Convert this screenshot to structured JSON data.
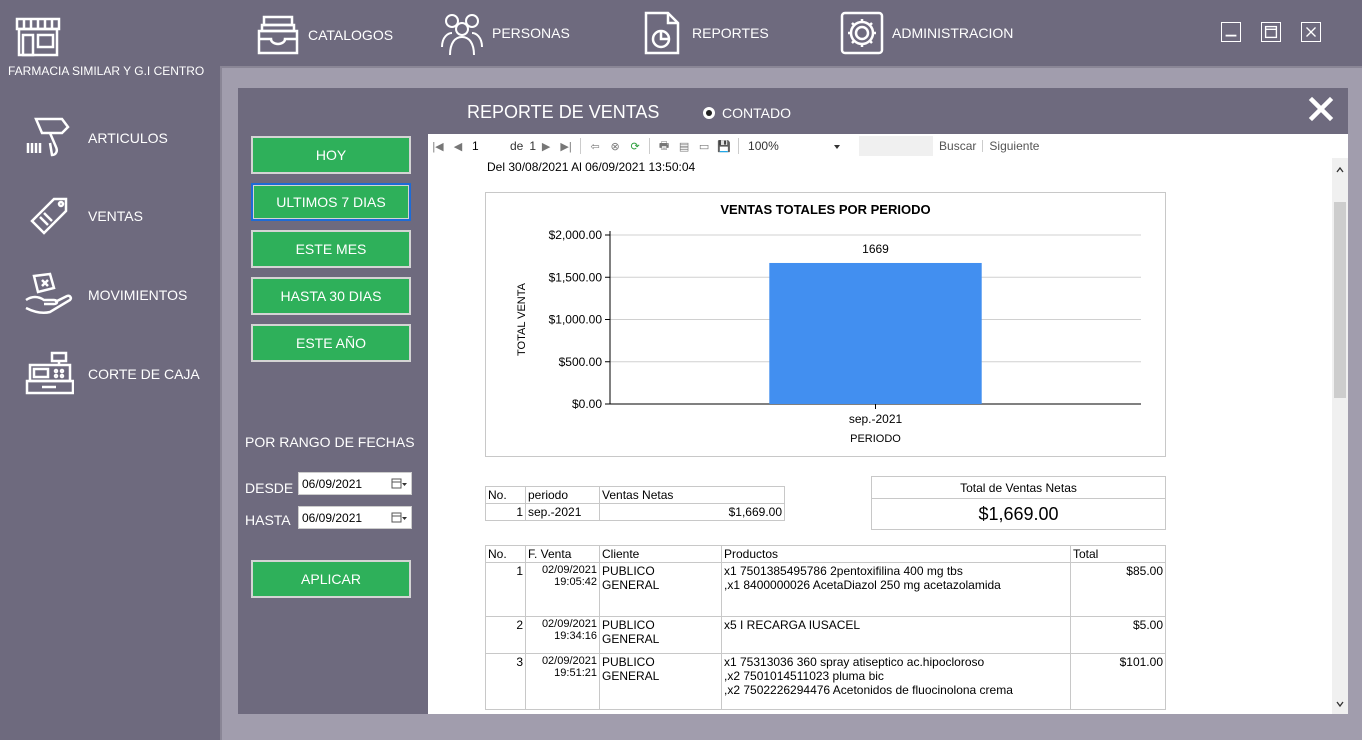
{
  "brand": {
    "name": "FARMACIA SIMILAR Y G.I CENTRO"
  },
  "topnav": {
    "catalogos": "CATALOGOS",
    "personas": "PERSONAS",
    "reportes": "REPORTES",
    "administracion": "ADMINISTRACION"
  },
  "sidebar": {
    "items": [
      {
        "label": "ARTICULOS"
      },
      {
        "label": "VENTAS"
      },
      {
        "label": "MOVIMIENTOS"
      },
      {
        "label": "CORTE DE CAJA"
      }
    ]
  },
  "report": {
    "title": "REPORTE DE VENTAS",
    "radio_label": "CONTADO",
    "buttons": {
      "hoy": "HOY",
      "ultimos7": "ULTIMOS 7 DIAS",
      "este_mes": "ESTE MES",
      "hasta30": "HASTA 30 DIAS",
      "este_anio": "ESTE AÑO",
      "aplicar": "APLICAR"
    },
    "range_label": "POR RANGO DE FECHAS",
    "desde_label": "DESDE",
    "desde_value": "06/09/2021",
    "hasta_label": "HASTA",
    "hasta_value": "06/09/2021"
  },
  "viewer": {
    "page_current": "1",
    "page_of": "de",
    "page_total": "1",
    "zoom": "100%",
    "buscar": "Buscar",
    "siguiente": "Siguiente",
    "date_range": "Del 30/08/2021 Al 06/09/2021 13:50:04"
  },
  "chart_data": {
    "type": "bar",
    "title": "VENTAS TOTALES POR PERIODO",
    "xlabel": "PERIODO",
    "ylabel": "TOTAL VENTA",
    "categories": [
      "sep.-2021"
    ],
    "values": [
      1669
    ],
    "data_labels": [
      "1669"
    ],
    "ylim": [
      0,
      2000
    ],
    "yticks": [
      0,
      500,
      1000,
      1500,
      2000
    ],
    "ytick_labels": [
      "$0.00",
      "$500.00",
      "$1,000.00",
      "$1,500.00",
      "$2,000.00"
    ],
    "bar_color": "#428ff0",
    "grid": true
  },
  "summary_table": {
    "headers": [
      "No.",
      "periodo",
      "Ventas Netas"
    ],
    "rows": [
      [
        "1",
        "sep.-2021",
        "$1,669.00"
      ]
    ]
  },
  "total_box": {
    "label": "Total de Ventas Netas",
    "value": "$1,669.00"
  },
  "detail_table": {
    "headers": [
      "No.",
      "F. Venta",
      "Cliente",
      "Productos",
      "Total"
    ],
    "rows": [
      {
        "no": "1",
        "fecha": "02/09/2021",
        "hora": "19:05:42",
        "cliente1": "PUBLICO",
        "cliente2": "GENERAL",
        "productos": [
          "x1 7501385495786 2pentoxifilina 400 mg tbs",
          ",x1 8400000026 AcetaDiazol 250 mg acetazolamida"
        ],
        "total": "$85.00"
      },
      {
        "no": "2",
        "fecha": "02/09/2021",
        "hora": "19:34:16",
        "cliente1": "PUBLICO",
        "cliente2": "GENERAL",
        "productos": [
          "x5 I RECARGA IUSACEL"
        ],
        "total": "$5.00"
      },
      {
        "no": "3",
        "fecha": "02/09/2021",
        "hora": "19:51:21",
        "cliente1": "PUBLICO",
        "cliente2": "GENERAL",
        "productos": [
          "x1 75313036 360 spray atiseptico ac.hipocloroso",
          ",x2 7501014511023 pluma bic",
          ",x2 7502226294476 Acetonidos de fluocinolona crema"
        ],
        "total": "$101.00"
      }
    ]
  },
  "colors": {
    "background": "#6e6a7e",
    "accent_green": "#2eb05a",
    "focus_blue": "#1e6bd6"
  },
  "icons": [
    "store-icon",
    "catalog-drawer-icon",
    "people-icon",
    "report-chart-icon",
    "gear-icon",
    "minimize-icon",
    "maximize-icon",
    "close-icon",
    "barcode-scanner-icon",
    "price-tag-icon",
    "money-hand-icon",
    "cash-register-icon",
    "close-x-icon",
    "calendar-icon"
  ]
}
